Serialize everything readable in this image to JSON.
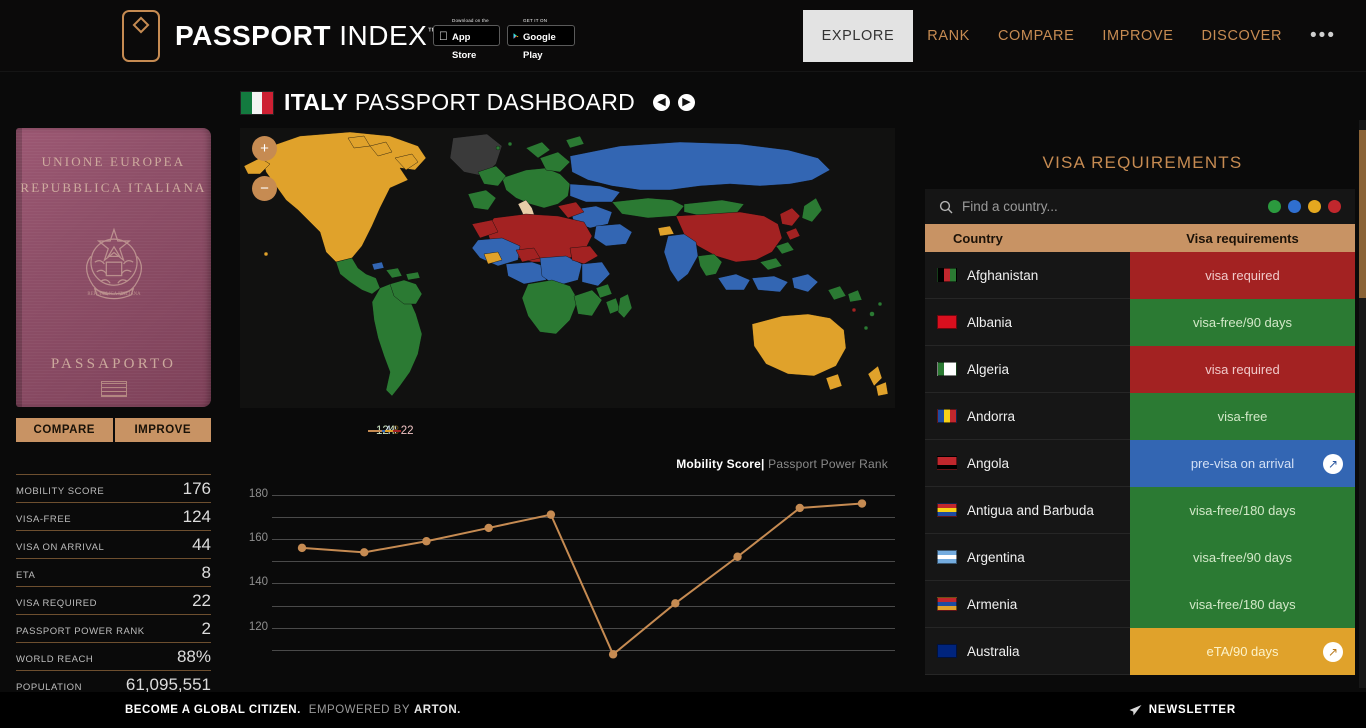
{
  "header": {
    "brand_bold": "PASSPORT",
    "brand_light": "INDEX",
    "brand_tm": "™",
    "logo_icon": "passport-badge-icon",
    "appstore": {
      "small": "Download on the",
      "big": "App Store",
      "icon": "apple-icon"
    },
    "googleplay": {
      "small": "GET IT ON",
      "big": "Google Play",
      "icon": "google-play-icon"
    },
    "nav": [
      {
        "label": "EXPLORE",
        "active": true
      },
      {
        "label": "RANK",
        "active": false
      },
      {
        "label": "COMPARE",
        "active": false
      },
      {
        "label": "IMPROVE",
        "active": false
      },
      {
        "label": "DISCOVER",
        "active": false
      }
    ],
    "nav_more": "•••"
  },
  "page": {
    "title_bold": "ITALY",
    "title_rest": " PASSPORT DASHBOARD",
    "flag": "italy-flag-icon",
    "prev_icon": "arrow-left-circle-icon",
    "next_icon": "arrow-right-circle-icon",
    "prev_glyph": "◀",
    "next_glyph": "▶"
  },
  "passport": {
    "line1": "UNIONE EUROPEA",
    "line2": "REPUBBLICA ITALIANA",
    "line3": "PASSAPORTO",
    "emblem": "italy-emblem-icon",
    "chip": "biometric-chip-icon"
  },
  "actions": {
    "compare": "COMPARE",
    "improve": "IMPROVE"
  },
  "stats": [
    {
      "label": "MOBILITY SCORE",
      "value": "176"
    },
    {
      "label": "VISA-FREE",
      "value": "124"
    },
    {
      "label": "VISA ON ARRIVAL",
      "value": "44"
    },
    {
      "label": "ETA",
      "value": "8"
    },
    {
      "label": "VISA REQUIRED",
      "value": "22"
    },
    {
      "label": "PASSPORT POWER RANK",
      "value": "2"
    },
    {
      "label": "WORLD REACH",
      "value": "88%"
    },
    {
      "label": "POPULATION",
      "value": "61,095,551"
    }
  ],
  "map": {
    "zoom_in": "+",
    "zoom_out": "−",
    "zoom_in_icon": "zoom-in-icon",
    "zoom_out_icon": "zoom-out-icon"
  },
  "breakdown": [
    {
      "value": "124",
      "color": "#2b7a33",
      "key": "visa-free"
    },
    {
      "value": "44",
      "color": "#3366b3",
      "key": "visa-on-arrival"
    },
    {
      "value": "8",
      "color": "#e0a22b",
      "key": "eta"
    },
    {
      "value": "22",
      "color": "#a32222",
      "key": "visa-required"
    }
  ],
  "chart_legend": {
    "active": "Mobility Score",
    "sep": "|",
    "inactive": "Passport Power Rank"
  },
  "chart_data": {
    "type": "line",
    "title": "Mobility Score",
    "xlabel": "",
    "ylabel": "",
    "ylim": [
      105,
      183
    ],
    "yticks": [
      120,
      140,
      160,
      180
    ],
    "gridlines": [
      110,
      120,
      130,
      140,
      150,
      160,
      170,
      180
    ],
    "grid": true,
    "legend": [
      "Mobility Score",
      "Passport Power Rank"
    ],
    "line_color": "#c68b52",
    "x": [
      1,
      2,
      3,
      4,
      5,
      6,
      7,
      8,
      9,
      10
    ],
    "values": [
      156,
      154,
      159,
      165,
      171,
      108,
      131,
      152,
      174,
      176
    ]
  },
  "visa_panel": {
    "title": "VISA REQUIREMENTS",
    "search_placeholder": "Find a country...",
    "search_value": "",
    "search_icon": "search-icon",
    "legend_dots": [
      {
        "color": "#2b9a3e",
        "key": "visa-free"
      },
      {
        "color": "#2f6fd0",
        "key": "visa-on-arrival"
      },
      {
        "color": "#e5a81f",
        "key": "eta"
      },
      {
        "color": "#c1272d",
        "key": "visa-required"
      }
    ],
    "columns": {
      "country": "Country",
      "requirement": "Visa requirements"
    },
    "rows": [
      {
        "country": "Afghanistan",
        "requirement": "visa required",
        "status": "red",
        "link": false
      },
      {
        "country": "Albania",
        "requirement": "visa-free/90 days",
        "status": "green",
        "link": false
      },
      {
        "country": "Algeria",
        "requirement": "visa required",
        "status": "red",
        "link": false
      },
      {
        "country": "Andorra",
        "requirement": "visa-free",
        "status": "green",
        "link": false
      },
      {
        "country": "Angola",
        "requirement": "pre-visa on arrival",
        "status": "blue",
        "link": true
      },
      {
        "country": "Antigua and Barbuda",
        "requirement": "visa-free/180 days",
        "status": "green",
        "link": false
      },
      {
        "country": "Argentina",
        "requirement": "visa-free/90 days",
        "status": "green",
        "link": false
      },
      {
        "country": "Armenia",
        "requirement": "visa-free/180 days",
        "status": "green",
        "link": false
      },
      {
        "country": "Australia",
        "requirement": "eTA/90 days",
        "status": "amber",
        "link": true
      }
    ]
  },
  "footer": {
    "tagline": "BECOME A GLOBAL CITIZEN.",
    "empowered": "EMPOWERED BY",
    "partner": "ARTON.",
    "newsletter": "NEWSLETTER",
    "newsletter_icon": "paper-plane-icon"
  }
}
